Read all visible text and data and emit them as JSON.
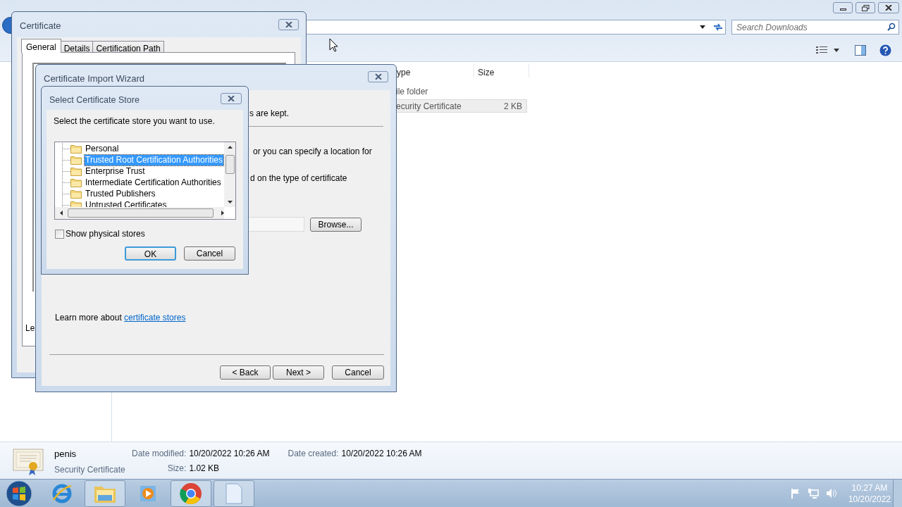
{
  "explorer": {
    "search": {
      "placeholder": "Search Downloads"
    },
    "columns": [
      "ype",
      "Size"
    ],
    "rows": [
      {
        "cells": [
          "ile folder"
        ],
        "selected": false
      },
      {
        "cells": [
          "ecurity Certificate",
          "2 KB"
        ],
        "selected": true
      }
    ]
  },
  "details_pane": {
    "name": "penis",
    "type": "Security Certificate",
    "date_modified": {
      "label": "Date modified:",
      "value": "10/20/2022 10:26 AM"
    },
    "size": {
      "label": "Size:",
      "value": "1.02 KB"
    },
    "date_created": {
      "label": "Date created:",
      "value": "10/20/2022 10:26 AM"
    }
  },
  "certificate_window": {
    "title": "Certificate",
    "tabs": [
      {
        "label": "General",
        "selected": true
      },
      {
        "label": "Details",
        "selected": false
      },
      {
        "label": "Certification Path",
        "selected": false
      }
    ],
    "partial_text": "Le"
  },
  "import_wizard": {
    "title": "Certificate Import Wizard",
    "partial_lines": [
      "s are kept.",
      "or you can specify a location for",
      "d on the type of certificate"
    ],
    "browse_button": "Browse...",
    "learn_more": {
      "text": "Learn more about",
      "link": "certificate stores"
    },
    "buttons": [
      "< Back",
      "Next >",
      "Cancel"
    ]
  },
  "store_dialog": {
    "title": "Select Certificate Store",
    "prompt": "Select the certificate store you want to use.",
    "stores": [
      {
        "label": "Personal",
        "selected": false
      },
      {
        "label": "Trusted Root Certification Authorities",
        "selected": true
      },
      {
        "label": "Enterprise Trust",
        "selected": false
      },
      {
        "label": "Intermediate Certification Authorities",
        "selected": false
      },
      {
        "label": "Trusted Publishers",
        "selected": false
      },
      {
        "label": "Untrusted Certificates",
        "selected": false
      }
    ],
    "show_physical_stores": {
      "label": "Show physical stores",
      "checked": false
    },
    "buttons": [
      {
        "label": "OK",
        "default": true
      },
      {
        "label": "Cancel",
        "default": false
      }
    ]
  },
  "taskbar": {
    "apps": [
      {
        "kind": "browser-e",
        "running": false
      },
      {
        "kind": "folder",
        "running": true
      },
      {
        "kind": "media",
        "running": false
      },
      {
        "kind": "chrome",
        "running": true
      },
      {
        "kind": "document",
        "running": true
      }
    ],
    "clock": {
      "time": "10:27 AM",
      "date": "10/20/2022"
    }
  }
}
